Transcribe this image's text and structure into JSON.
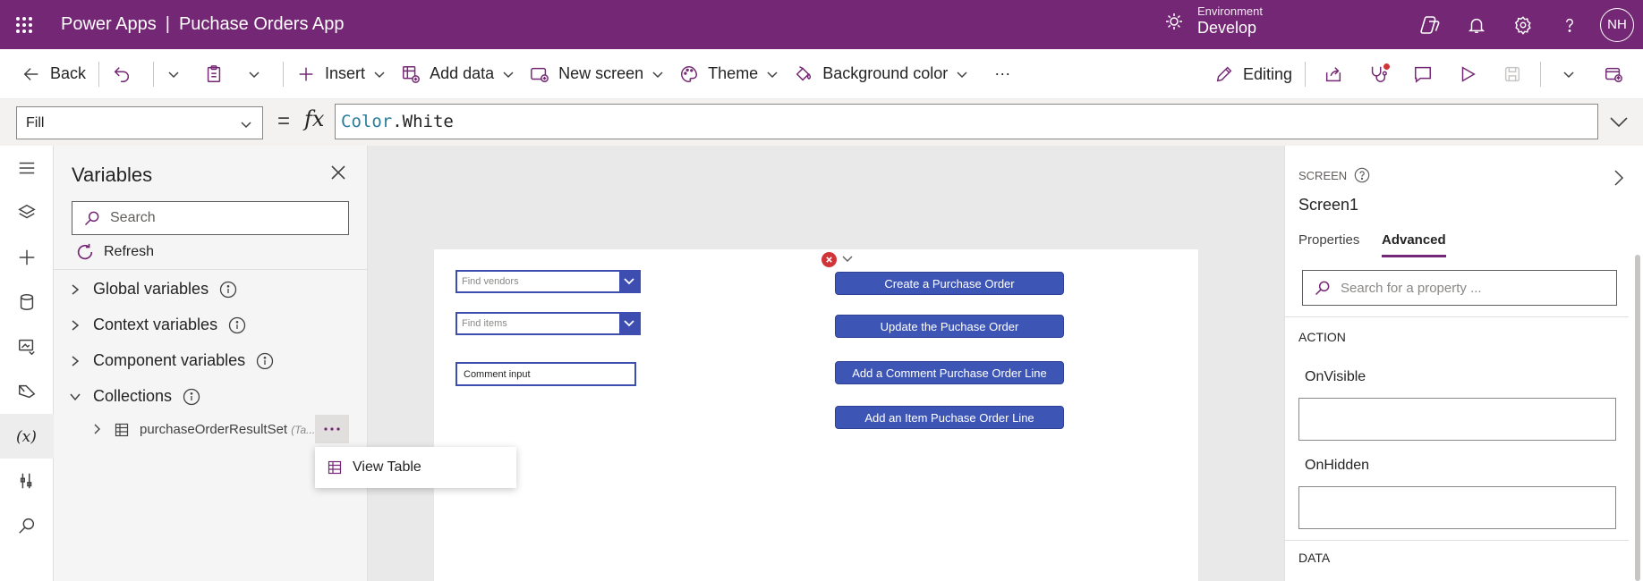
{
  "header": {
    "app_name": "Power Apps",
    "separator": "|",
    "document_name": "Puchase Orders App",
    "environment_label": "Environment",
    "environment_value": "Develop",
    "avatar_initials": "NH"
  },
  "toolbar": {
    "back": "Back",
    "insert": "Insert",
    "add_data": "Add data",
    "new_screen": "New screen",
    "theme": "Theme",
    "background_color": "Background color",
    "more": "···",
    "editing": "Editing"
  },
  "formula_bar": {
    "property": "Fill",
    "equals": "=",
    "fx": "fx",
    "formula_keyword": "Color",
    "formula_rest": ".White"
  },
  "variables_panel": {
    "title": "Variables",
    "search_placeholder": "Search",
    "refresh": "Refresh",
    "groups": [
      {
        "label": "Global variables"
      },
      {
        "label": "Context variables"
      },
      {
        "label": "Component variables"
      },
      {
        "label": "Collections"
      }
    ],
    "collection_item": {
      "name": "purchaseOrderResultSet",
      "type_hint": "(Ta..."
    },
    "context_menu": {
      "view_table": "View Table"
    }
  },
  "canvas": {
    "find_vendors_placeholder": "Find vendors",
    "find_items_placeholder": "Find items",
    "comment_input": "Comment input",
    "buttons": [
      "Create a Purchase Order",
      "Update the Puchase Order",
      "Add a Comment Purchase Order Line",
      "Add an Item Puchase Order Line"
    ]
  },
  "right_panel": {
    "kind": "SCREEN",
    "name": "Screen1",
    "tabs": [
      "Properties",
      "Advanced"
    ],
    "active_tab": "Advanced",
    "search_placeholder": "Search for a property ...",
    "section_action": "ACTION",
    "on_visible": "OnVisible",
    "on_hidden": "OnHidden",
    "section_data": "DATA"
  },
  "colors": {
    "brand": "#742774",
    "control_accent": "#3d56b5",
    "error": "#d13438"
  }
}
